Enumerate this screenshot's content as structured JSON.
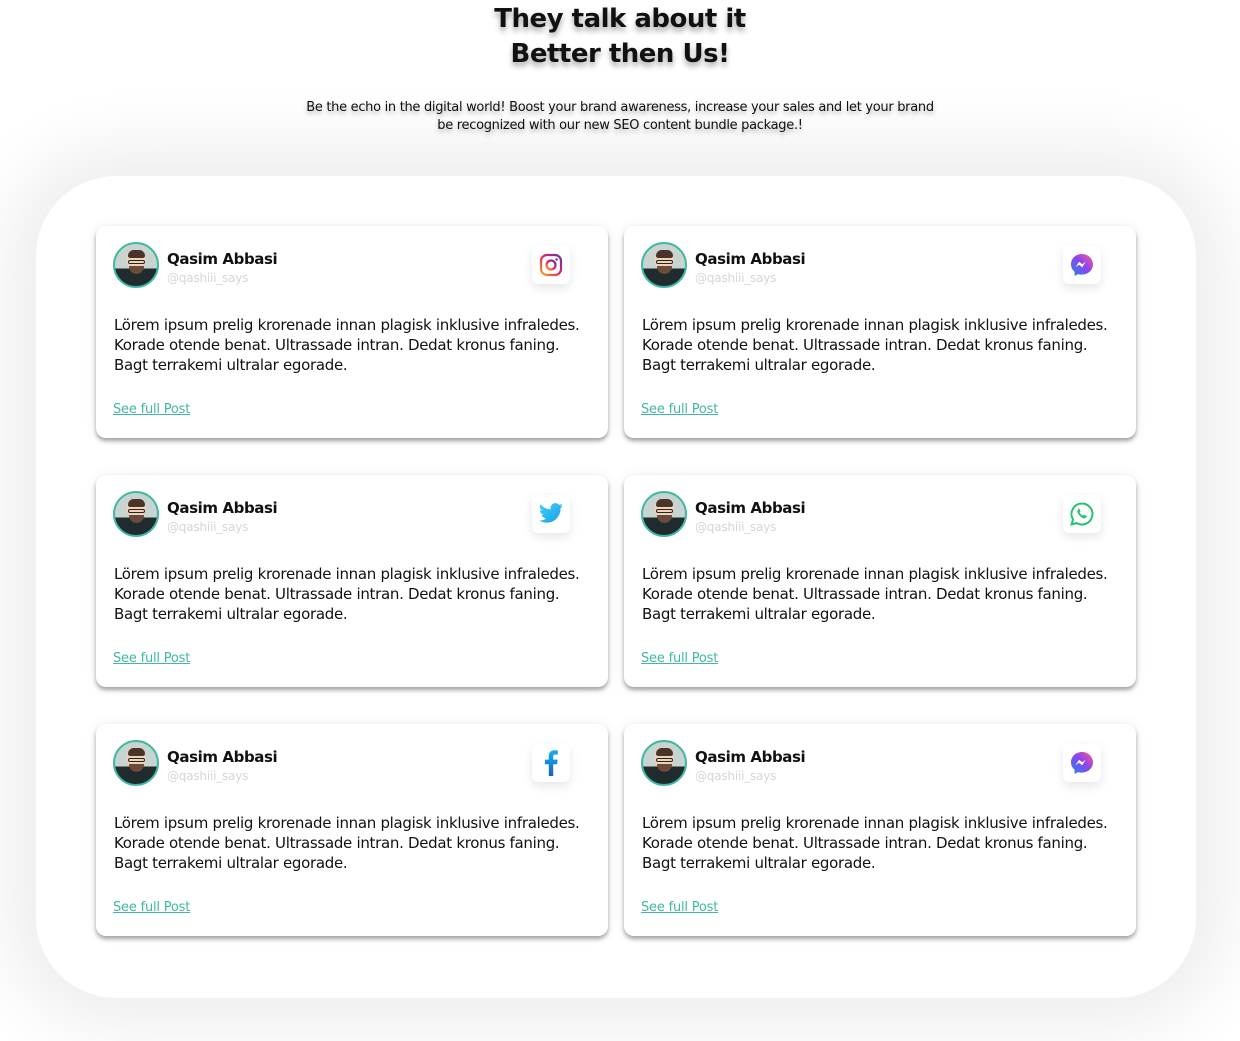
{
  "header": {
    "title_line1": "They talk about it",
    "title_line2": "Better then Us!",
    "subtitle": "Be the echo in the digital world! Boost your brand awareness, increase your sales and let your brand be recognized with our new SEO content bundle package.!"
  },
  "colors": {
    "accent": "#3fb8a4",
    "handle": "#d6d6d6"
  },
  "cards": [
    {
      "name": "Qasim Abbasi",
      "handle": "@qashiii_says",
      "platform": "instagram-icon",
      "text": "Lörem ipsum prelig krorenade innan plagisk inklusive infraledes. Korade otende benat. Ultrassade intran. Dedat kronus faning. Bagt terrakemi ultralar egorade.",
      "link": "See full Post"
    },
    {
      "name": "Qasim Abbasi",
      "handle": "@qashiii_says",
      "platform": "messenger-icon",
      "text": "Lörem ipsum prelig krorenade innan plagisk inklusive infraledes. Korade otende benat. Ultrassade intran. Dedat kronus faning. Bagt terrakemi ultralar egorade.",
      "link": "See full Post"
    },
    {
      "name": "Qasim Abbasi",
      "handle": "@qashiii_says",
      "platform": "twitter-icon",
      "text": "Lörem ipsum prelig krorenade innan plagisk inklusive infraledes. Korade otende benat. Ultrassade intran. Dedat kronus faning. Bagt terrakemi ultralar egorade.",
      "link": "See full Post"
    },
    {
      "name": "Qasim Abbasi",
      "handle": "@qashiii_says",
      "platform": "whatsapp-icon",
      "text": "Lörem ipsum prelig krorenade innan plagisk inklusive infraledes. Korade otende benat. Ultrassade intran. Dedat kronus faning. Bagt terrakemi ultralar egorade.",
      "link": "See full Post"
    },
    {
      "name": "Qasim Abbasi",
      "handle": "@qashiii_says",
      "platform": "facebook-icon",
      "text": "Lörem ipsum prelig krorenade innan plagisk inklusive infraledes. Korade otende benat. Ultrassade intran. Dedat kronus faning. Bagt terrakemi ultralar egorade.",
      "link": "See full Post"
    },
    {
      "name": "Qasim Abbasi",
      "handle": "@qashiii_says",
      "platform": "messenger-icon",
      "text": "Lörem ipsum prelig krorenade innan plagisk inklusive infraledes. Korade otende benat. Ultrassade intran. Dedat kronus faning. Bagt terrakemi ultralar egorade.",
      "link": "See full Post"
    }
  ]
}
